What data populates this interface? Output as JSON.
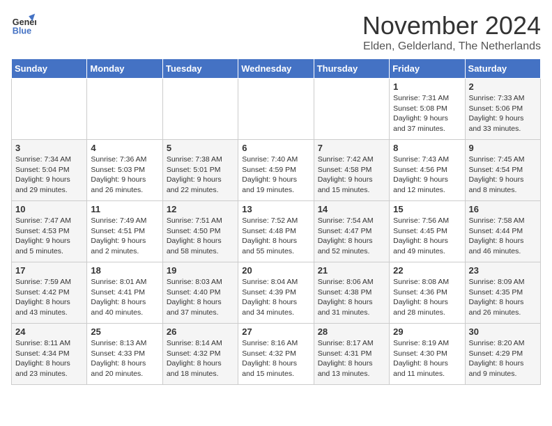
{
  "logo": {
    "line1": "General",
    "line2": "Blue"
  },
  "title": "November 2024",
  "location": "Elden, Gelderland, The Netherlands",
  "days_header": [
    "Sunday",
    "Monday",
    "Tuesday",
    "Wednesday",
    "Thursday",
    "Friday",
    "Saturday"
  ],
  "weeks": [
    [
      {
        "day": "",
        "sunrise": "",
        "sunset": "",
        "daylight": ""
      },
      {
        "day": "",
        "sunrise": "",
        "sunset": "",
        "daylight": ""
      },
      {
        "day": "",
        "sunrise": "",
        "sunset": "",
        "daylight": ""
      },
      {
        "day": "",
        "sunrise": "",
        "sunset": "",
        "daylight": ""
      },
      {
        "day": "",
        "sunrise": "",
        "sunset": "",
        "daylight": ""
      },
      {
        "day": "1",
        "sunrise": "Sunrise: 7:31 AM",
        "sunset": "Sunset: 5:08 PM",
        "daylight": "Daylight: 9 hours and 37 minutes."
      },
      {
        "day": "2",
        "sunrise": "Sunrise: 7:33 AM",
        "sunset": "Sunset: 5:06 PM",
        "daylight": "Daylight: 9 hours and 33 minutes."
      }
    ],
    [
      {
        "day": "3",
        "sunrise": "Sunrise: 7:34 AM",
        "sunset": "Sunset: 5:04 PM",
        "daylight": "Daylight: 9 hours and 29 minutes."
      },
      {
        "day": "4",
        "sunrise": "Sunrise: 7:36 AM",
        "sunset": "Sunset: 5:03 PM",
        "daylight": "Daylight: 9 hours and 26 minutes."
      },
      {
        "day": "5",
        "sunrise": "Sunrise: 7:38 AM",
        "sunset": "Sunset: 5:01 PM",
        "daylight": "Daylight: 9 hours and 22 minutes."
      },
      {
        "day": "6",
        "sunrise": "Sunrise: 7:40 AM",
        "sunset": "Sunset: 4:59 PM",
        "daylight": "Daylight: 9 hours and 19 minutes."
      },
      {
        "day": "7",
        "sunrise": "Sunrise: 7:42 AM",
        "sunset": "Sunset: 4:58 PM",
        "daylight": "Daylight: 9 hours and 15 minutes."
      },
      {
        "day": "8",
        "sunrise": "Sunrise: 7:43 AM",
        "sunset": "Sunset: 4:56 PM",
        "daylight": "Daylight: 9 hours and 12 minutes."
      },
      {
        "day": "9",
        "sunrise": "Sunrise: 7:45 AM",
        "sunset": "Sunset: 4:54 PM",
        "daylight": "Daylight: 9 hours and 8 minutes."
      }
    ],
    [
      {
        "day": "10",
        "sunrise": "Sunrise: 7:47 AM",
        "sunset": "Sunset: 4:53 PM",
        "daylight": "Daylight: 9 hours and 5 minutes."
      },
      {
        "day": "11",
        "sunrise": "Sunrise: 7:49 AM",
        "sunset": "Sunset: 4:51 PM",
        "daylight": "Daylight: 9 hours and 2 minutes."
      },
      {
        "day": "12",
        "sunrise": "Sunrise: 7:51 AM",
        "sunset": "Sunset: 4:50 PM",
        "daylight": "Daylight: 8 hours and 58 minutes."
      },
      {
        "day": "13",
        "sunrise": "Sunrise: 7:52 AM",
        "sunset": "Sunset: 4:48 PM",
        "daylight": "Daylight: 8 hours and 55 minutes."
      },
      {
        "day": "14",
        "sunrise": "Sunrise: 7:54 AM",
        "sunset": "Sunset: 4:47 PM",
        "daylight": "Daylight: 8 hours and 52 minutes."
      },
      {
        "day": "15",
        "sunrise": "Sunrise: 7:56 AM",
        "sunset": "Sunset: 4:45 PM",
        "daylight": "Daylight: 8 hours and 49 minutes."
      },
      {
        "day": "16",
        "sunrise": "Sunrise: 7:58 AM",
        "sunset": "Sunset: 4:44 PM",
        "daylight": "Daylight: 8 hours and 46 minutes."
      }
    ],
    [
      {
        "day": "17",
        "sunrise": "Sunrise: 7:59 AM",
        "sunset": "Sunset: 4:42 PM",
        "daylight": "Daylight: 8 hours and 43 minutes."
      },
      {
        "day": "18",
        "sunrise": "Sunrise: 8:01 AM",
        "sunset": "Sunset: 4:41 PM",
        "daylight": "Daylight: 8 hours and 40 minutes."
      },
      {
        "day": "19",
        "sunrise": "Sunrise: 8:03 AM",
        "sunset": "Sunset: 4:40 PM",
        "daylight": "Daylight: 8 hours and 37 minutes."
      },
      {
        "day": "20",
        "sunrise": "Sunrise: 8:04 AM",
        "sunset": "Sunset: 4:39 PM",
        "daylight": "Daylight: 8 hours and 34 minutes."
      },
      {
        "day": "21",
        "sunrise": "Sunrise: 8:06 AM",
        "sunset": "Sunset: 4:38 PM",
        "daylight": "Daylight: 8 hours and 31 minutes."
      },
      {
        "day": "22",
        "sunrise": "Sunrise: 8:08 AM",
        "sunset": "Sunset: 4:36 PM",
        "daylight": "Daylight: 8 hours and 28 minutes."
      },
      {
        "day": "23",
        "sunrise": "Sunrise: 8:09 AM",
        "sunset": "Sunset: 4:35 PM",
        "daylight": "Daylight: 8 hours and 26 minutes."
      }
    ],
    [
      {
        "day": "24",
        "sunrise": "Sunrise: 8:11 AM",
        "sunset": "Sunset: 4:34 PM",
        "daylight": "Daylight: 8 hours and 23 minutes."
      },
      {
        "day": "25",
        "sunrise": "Sunrise: 8:13 AM",
        "sunset": "Sunset: 4:33 PM",
        "daylight": "Daylight: 8 hours and 20 minutes."
      },
      {
        "day": "26",
        "sunrise": "Sunrise: 8:14 AM",
        "sunset": "Sunset: 4:32 PM",
        "daylight": "Daylight: 8 hours and 18 minutes."
      },
      {
        "day": "27",
        "sunrise": "Sunrise: 8:16 AM",
        "sunset": "Sunset: 4:32 PM",
        "daylight": "Daylight: 8 hours and 15 minutes."
      },
      {
        "day": "28",
        "sunrise": "Sunrise: 8:17 AM",
        "sunset": "Sunset: 4:31 PM",
        "daylight": "Daylight: 8 hours and 13 minutes."
      },
      {
        "day": "29",
        "sunrise": "Sunrise: 8:19 AM",
        "sunset": "Sunset: 4:30 PM",
        "daylight": "Daylight: 8 hours and 11 minutes."
      },
      {
        "day": "30",
        "sunrise": "Sunrise: 8:20 AM",
        "sunset": "Sunset: 4:29 PM",
        "daylight": "Daylight: 8 hours and 9 minutes."
      }
    ]
  ]
}
